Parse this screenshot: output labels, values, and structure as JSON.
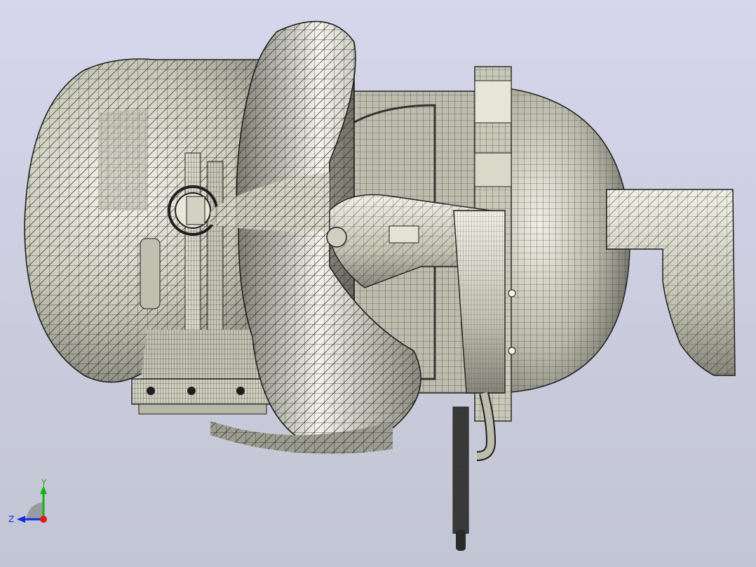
{
  "viewport": {
    "background_top": "#d6d6ec",
    "background_bottom": "#c2c5d3",
    "model_fill": "#cfcfc0",
    "mesh_color": "#2b2b2b"
  },
  "triad": {
    "y_label": "Y",
    "z_label": "Z",
    "y_color": "#18b018",
    "z_color": "#1030e0",
    "x_color": "#e01818"
  }
}
